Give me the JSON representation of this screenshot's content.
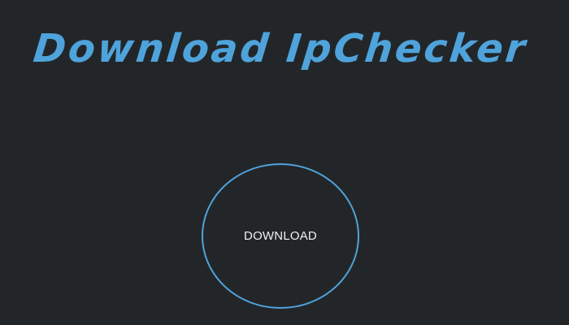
{
  "header": {
    "title": "Download IpChecker"
  },
  "main": {
    "download_button_label": "DOWNLOAD"
  },
  "colors": {
    "background": "#232629",
    "accent": "#4fa3db",
    "button_text": "#f2f2f2"
  }
}
